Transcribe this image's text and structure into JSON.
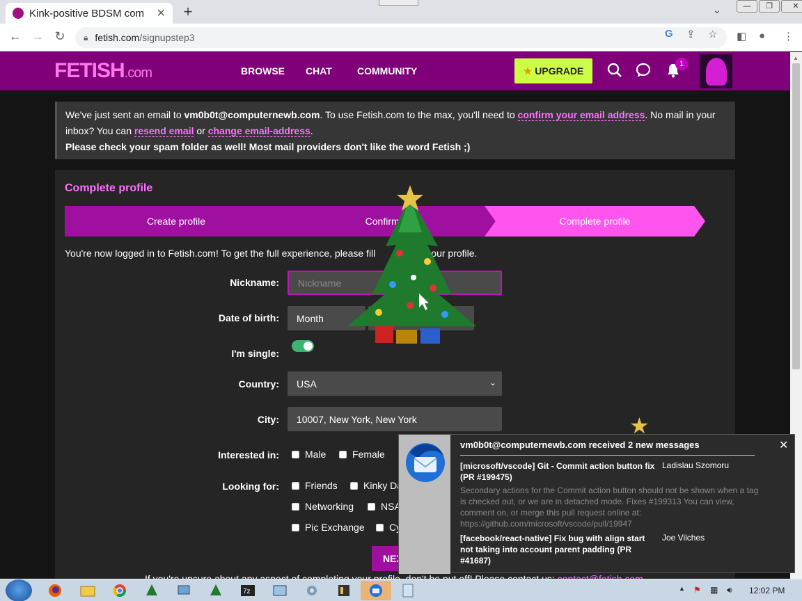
{
  "browser": {
    "tab_title": "Kink-positive BDSM com",
    "tab_close": "✕",
    "new_tab": "+",
    "url_host": "fetish.com",
    "url_path": "/signupstep3"
  },
  "header": {
    "logo_main": "FETISH",
    "logo_suffix": ".com",
    "nav": [
      "BROWSE",
      "CHAT",
      "COMMUNITY"
    ],
    "upgrade_label": "UPGRADE",
    "notifications_count": "1"
  },
  "notice": {
    "line1_pre": "We've just sent an email to ",
    "email": "vm0b0t@computernewb.com",
    "line1_mid": ". To use Fetish.com to the max, you'll need to ",
    "confirm_link": "confirm your email address",
    "line1_post": ". No mail in your",
    "line2_pre": "inbox? You can ",
    "resend_link": "resend email",
    "line2_or": " or ",
    "change_link": "change email-address",
    "line2_post": ".",
    "line3": "Please check your spam folder as well! Most mail providers don't like the word Fetish ;)"
  },
  "profile": {
    "title": "Complete profile",
    "steps": [
      "Create profile",
      "Confirm e",
      "Complete profile"
    ],
    "intro_a": "You're now logged in to Fetish.com! To get the full experience, please fill",
    "intro_b": "our profile.",
    "nickname_label": "Nickname:",
    "nickname_placeholder": "Nickname",
    "dob_label": "Date of birth:",
    "dob_month": "Month",
    "single_label": "I'm single:",
    "country_label": "Country:",
    "country_value": "USA",
    "city_label": "City:",
    "city_value": "10007, New York, New York",
    "interested_label": "Interested in:",
    "interested_options": [
      "Male",
      "Female"
    ],
    "looking_label": "Looking for:",
    "looking_options": [
      "Friends",
      "Kinky Da",
      "Networking",
      "NSA",
      "Pic Exchange",
      "Cy"
    ],
    "next_label": "NEX",
    "footnote": "If you're unsure about any aspect of completing your profile, don't be put off! Please contact us: ",
    "footnote_link": "contact@fetish.com"
  },
  "toast": {
    "heading": "vm0b0t@computernewb.com received 2 new messages",
    "messages": [
      {
        "subject": "[microsoft/vscode] Git - Commit action button fix (PR #199475)",
        "from": "Ladislau Szomoru",
        "preview": "Secondary actions for the Commit action button should not be shown when a tag is checked out, or we are in detached mode. Fixes #199313 You can view, comment on, or merge this pull request online at: https://github.com/microsoft/vscode/pull/19947"
      },
      {
        "subject": "[facebook/react-native] Fix bug with align start not taking into account parent padding (PR #41687)",
        "from": "Joe Vilches"
      }
    ]
  },
  "taskbar": {
    "clock": "12:02 PM"
  },
  "colors": {
    "brand_purple": "#80007a",
    "accent_pink": "#ff6fff",
    "upgrade_green": "#ccff44",
    "step_dark": "#a010a0",
    "step_active": "#ff55ee"
  }
}
